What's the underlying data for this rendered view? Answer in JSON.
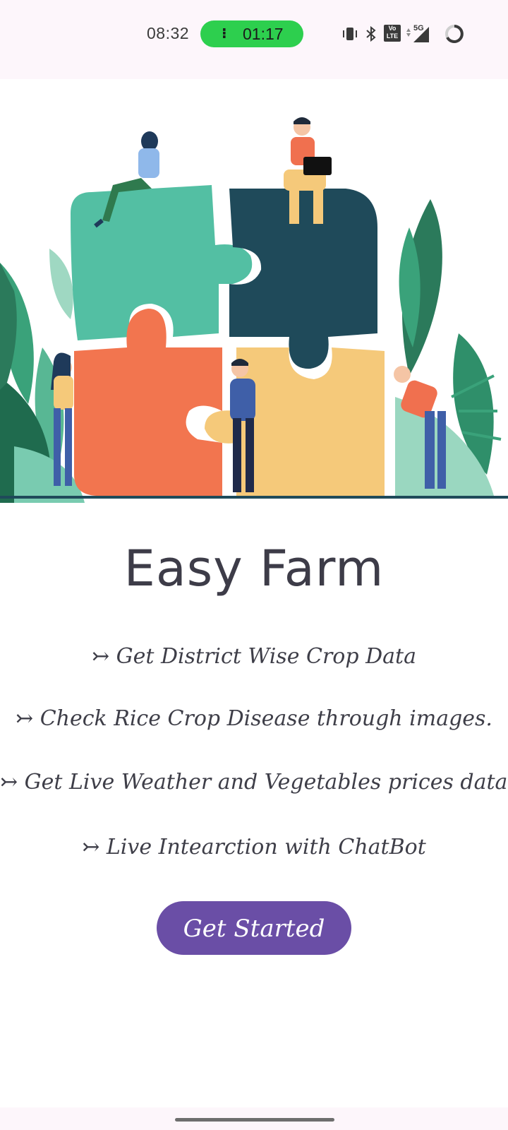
{
  "status_bar": {
    "time": "08:32",
    "call_timer": "01:17",
    "icons": [
      "vibrate-icon",
      "bluetooth-icon",
      "volte-icon",
      "5g-signal-icon",
      "battery-ring-icon"
    ],
    "network_label": "5G",
    "volte_label": "Vo LTE",
    "call_color": "#2dcf4e"
  },
  "hero": {
    "illustration": "team-puzzle-illustration",
    "colors": [
      "#53bfa3",
      "#1f4a5a",
      "#f2754f",
      "#f5c97a"
    ]
  },
  "main": {
    "title": "Easy Farm",
    "features": [
      "↣ Get District Wise Crop Data",
      "↣ Check Rice Crop Disease through images.",
      "↣ Get Live Weather and Vegetables prices data.",
      "↣ Live Intearction with ChatBot"
    ],
    "cta_label": "Get Started",
    "cta_color": "#6a4ea6"
  }
}
